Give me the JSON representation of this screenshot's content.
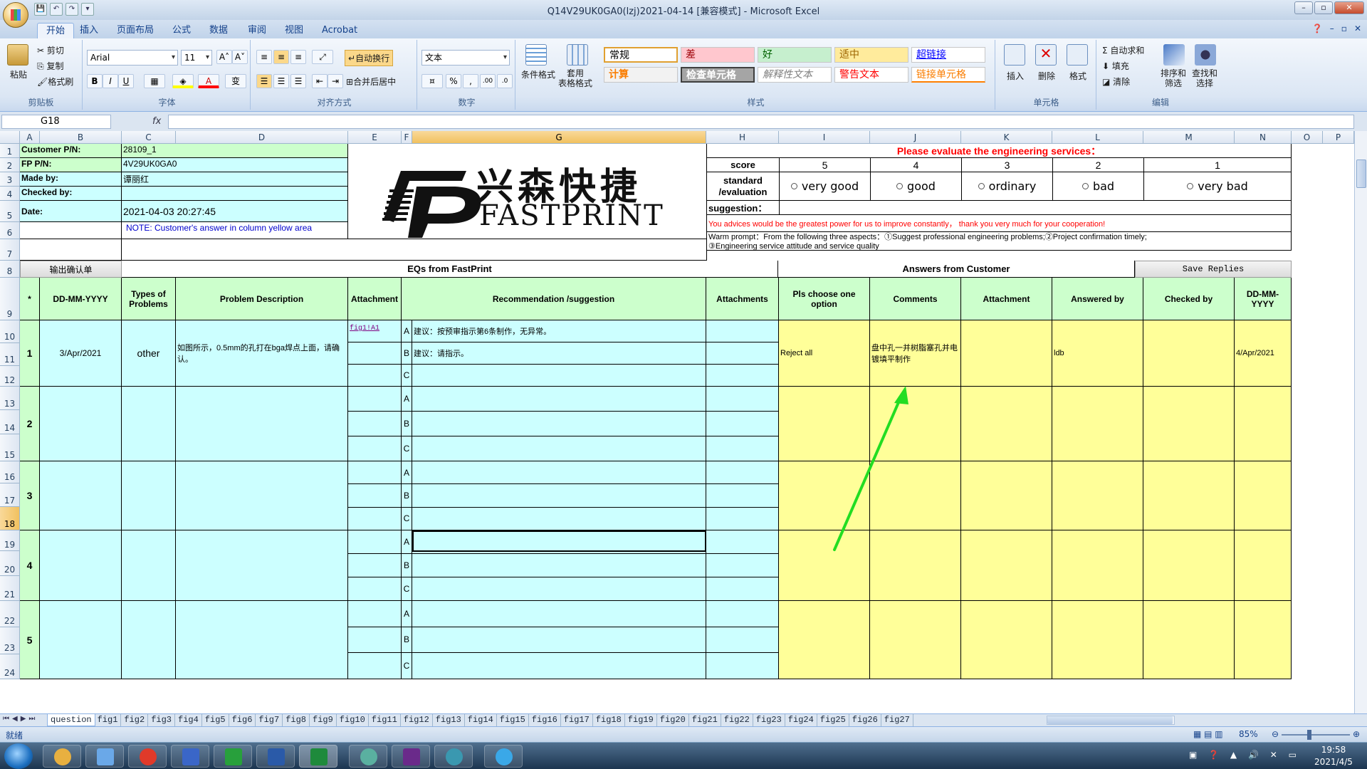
{
  "window": {
    "title": "Q14V29UK0GA0(lzj)2021-04-14  [兼容模式] - Microsoft Excel",
    "min": "–",
    "max": "▫",
    "close": "✕"
  },
  "ribbon_tabs": [
    "开始",
    "插入",
    "页面布局",
    "公式",
    "数据",
    "审阅",
    "视图",
    "Acrobat"
  ],
  "clipboard": {
    "paste": "粘贴",
    "cut": "剪切",
    "copy": "复制",
    "format_painter": "格式刷",
    "label": "剪贴板"
  },
  "font": {
    "name": "Arial",
    "size": "11",
    "bold": "B",
    "italic": "I",
    "underline": "U",
    "grow": "A˄",
    "shrink": "A˅",
    "color_a": "A",
    "wen": "变",
    "label": "字体"
  },
  "alignment": {
    "wrap": "自动换行",
    "merge": "合并后居中",
    "label": "对齐方式"
  },
  "number": {
    "format": "文本",
    "percent": "%",
    "comma": ",",
    "inc": ".00",
    "dec": ".0",
    "label": "数字"
  },
  "styles": {
    "conditional": "条件格式",
    "table": "套用\n表格格式",
    "cells": [
      "常规",
      "差",
      "好",
      "适中",
      "超链接",
      "计算",
      "检查单元格",
      "解释性文本",
      "警告文本",
      "链接单元格"
    ],
    "label": "样式"
  },
  "cells_group": {
    "insert": "插入",
    "delete": "删除",
    "format": "格式",
    "label": "单元格"
  },
  "editing": {
    "autosum": "Σ 自动求和",
    "fill": "填充",
    "clear": "清除",
    "sort": "排序和\n筛选",
    "find": "查找和\n选择",
    "label": "编辑"
  },
  "formula_bar": {
    "name_box": "G18",
    "fx": "fx",
    "value": ""
  },
  "columns": [
    "A",
    "B",
    "C",
    "D",
    "E",
    "F",
    "G",
    "H",
    "I",
    "J",
    "K",
    "L",
    "M",
    "N",
    "O",
    "P"
  ],
  "rows": [
    "1",
    "2",
    "3",
    "4",
    "5",
    "6",
    "7",
    "8",
    "9",
    "10",
    "11",
    "12",
    "13",
    "14",
    "15",
    "16",
    "17",
    "18",
    "19",
    "20",
    "21",
    "22",
    "23",
    "24"
  ],
  "header_info": {
    "customer_pn_label": "Customer P/N:",
    "customer_pn": "28109_1",
    "fp_pn_label": "FP P/N:",
    "fp_pn": "4V29UK0GA0",
    "made_by_label": "Made by:",
    "made_by": "谭丽红",
    "checked_by_label": "Checked by:",
    "checked_by": "",
    "date_label": "Date:",
    "date": "2021-04-03 20:27:45",
    "note": "NOTE: Customer's  answer in column yellow area"
  },
  "logo": {
    "cn": "兴森快捷",
    "en": "FASTPRINT"
  },
  "evaluation": {
    "title": "Please evaluate the engineering services：",
    "score_label": "score",
    "scores": [
      "5",
      "4",
      "3",
      "2",
      "1"
    ],
    "standard_label": "standard\n/evaluation",
    "options": [
      "very good",
      "good",
      "ordinary",
      "bad",
      "very bad"
    ],
    "suggestion_label": "suggestion：",
    "advice": "You advices would be the greatest power for us to improve constantly， thank you very much for your cooperation!",
    "warm_prompt": "Warm prompt：From the following three aspects：①Suggest professional engineering problems;②Project confirmation timely;\n③Engineering service attitude and service quality"
  },
  "sections": {
    "confirm_button": "输出确认单",
    "eq_title": "EQs from FastPrint",
    "answers_title": "Answers from Customer",
    "save_button": "Save Replies"
  },
  "table_headers": {
    "star": "*",
    "date": "DD-MM-YYYY",
    "types": "Types of Problems",
    "description": "Problem Description",
    "attachment": "Attachment",
    "recommendation": "Recommendation /suggestion",
    "attachments": "Attachments",
    "choose": "Pls choose one option",
    "comments": "Comments",
    "attachment2": "Attachment",
    "answered_by": "Answered by",
    "checked_by": "Checked by",
    "date2": "DD-MM-YYYY"
  },
  "eq_rows": [
    {
      "no": "1",
      "date": "3/Apr/2021",
      "type": "other",
      "description": "如图所示，0.5mm的孔打在bga焊点上面，请确认。",
      "attachment": "fig1!A1",
      "options": [
        {
          "letter": "A",
          "text": "建议：按预审指示第6条制作，无异常。"
        },
        {
          "letter": "B",
          "text": "建议：请指示。"
        },
        {
          "letter": "C",
          "text": ""
        }
      ],
      "choice": "Reject all",
      "comment": "盘中孔一并树脂塞孔并电镀填平制作",
      "answered_by": "ldb",
      "checked_by": "",
      "answer_date": "4/Apr/2021"
    },
    {
      "no": "2",
      "options": [
        {
          "letter": "A",
          "text": ""
        },
        {
          "letter": "B",
          "text": ""
        },
        {
          "letter": "C",
          "text": ""
        }
      ]
    },
    {
      "no": "3",
      "options": [
        {
          "letter": "A",
          "text": ""
        },
        {
          "letter": "B",
          "text": ""
        },
        {
          "letter": "C",
          "text": ""
        }
      ]
    },
    {
      "no": "4",
      "options": [
        {
          "letter": "A",
          "text": ""
        },
        {
          "letter": "B",
          "text": ""
        },
        {
          "letter": "C",
          "text": ""
        }
      ]
    },
    {
      "no": "5",
      "options": [
        {
          "letter": "A",
          "text": ""
        },
        {
          "letter": "B",
          "text": ""
        },
        {
          "letter": "C",
          "text": ""
        }
      ]
    }
  ],
  "sheet_tabs": [
    "question",
    "fig1",
    "fig2",
    "fig3",
    "fig4",
    "fig5",
    "fig6",
    "fig7",
    "fig8",
    "fig9",
    "fig10",
    "fig11",
    "fig12",
    "fig13",
    "fig14",
    "fig15",
    "fig16",
    "fig17",
    "fig18",
    "fig19",
    "fig20",
    "fig21",
    "fig22",
    "fig23",
    "fig24",
    "fig25",
    "fig26",
    "fig27"
  ],
  "status": {
    "ready": "就绪",
    "zoom": "85%"
  },
  "taskbar": {
    "time": "19:58",
    "date": "2021/4/5"
  },
  "colors": {
    "green_cell": "#ccffcc",
    "cyan_cell": "#ccffff",
    "yellow_cell": "#ffff99",
    "annotation_arrow": "#22dd22",
    "red_text": "#ff0000"
  }
}
